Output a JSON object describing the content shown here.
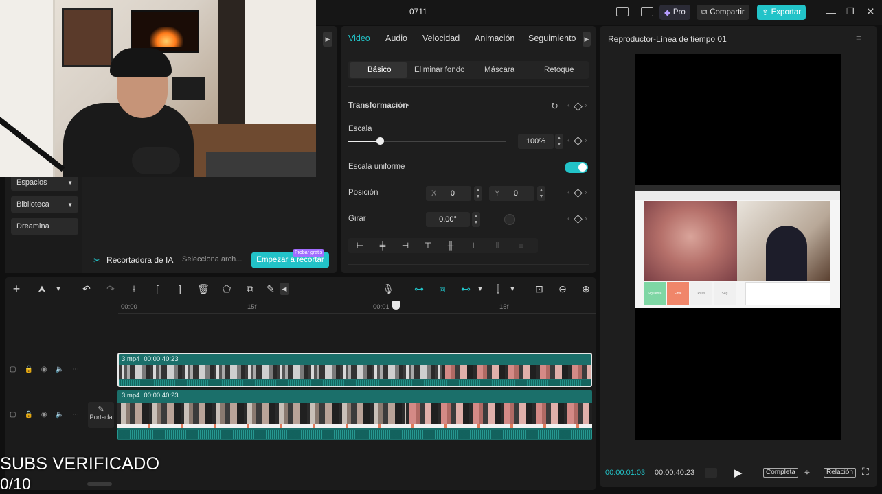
{
  "app": {
    "title": "0711",
    "pro_label": "Pro",
    "share_label": "Compartir",
    "export_label": "Exportar",
    "accent": "#22c3c8"
  },
  "sidebar": {
    "items": [
      {
        "label": "Espacios"
      },
      {
        "label": "Biblioteca"
      },
      {
        "label": "Dreamina"
      }
    ]
  },
  "ai_cutter": {
    "label": "Recortadora de IA",
    "select_text": "Selecciona arch...",
    "start_button": "Empezar a recortar",
    "badge": "Probar gratis"
  },
  "inspector": {
    "tabs": [
      "Video",
      "Audio",
      "Velocidad",
      "Animación",
      "Seguimiento"
    ],
    "active_tab": "Video",
    "subtabs": [
      "Básico",
      "Eliminar fondo",
      "Máscara",
      "Retoque"
    ],
    "active_subtab": "Básico",
    "section_title": "Transformación",
    "scale_label": "Escala",
    "scale_value": "100%",
    "scale_fraction": 0.2,
    "uniform_scale_label": "Escala uniforme",
    "uniform_scale_on": true,
    "position_label": "Posición",
    "pos_x_label": "X",
    "pos_x_value": "0",
    "pos_y_label": "Y",
    "pos_y_value": "0",
    "rotate_label": "Girar",
    "rotate_value": "0.00°"
  },
  "timeline": {
    "ruler": [
      "00:00",
      "15f",
      "00:01",
      "15f"
    ],
    "clip1": {
      "name": "3.mp4",
      "duration": "00:00:40:23"
    },
    "clip2": {
      "name": "3.mp4",
      "duration": "00:00:40:23"
    },
    "cover_label": "Portada"
  },
  "player": {
    "title": "Reproductor-Línea de tiempo 01",
    "current_time": "00:00:01:03",
    "total_time": "00:00:40:23",
    "complete_label": "Completa",
    "ratio_label": "Relación",
    "preview_buttons": [
      "Siguiente",
      "Final",
      "Pass",
      "Seg"
    ]
  },
  "overlay": {
    "line1": "SUBS VERIFICADO",
    "line2": "0/10"
  }
}
